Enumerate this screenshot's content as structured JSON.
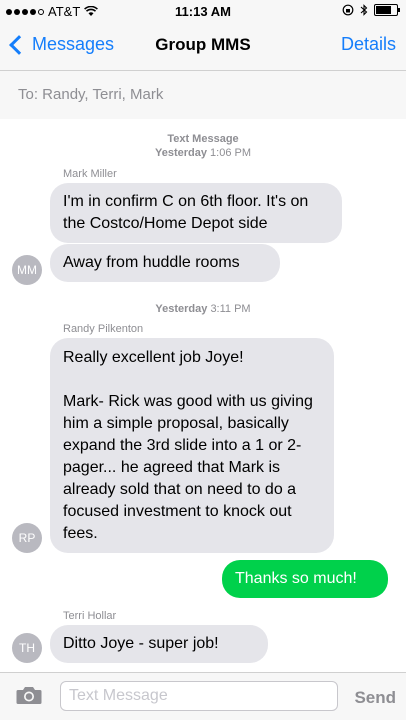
{
  "status_bar": {
    "carrier": "AT&T",
    "time": "11:13 AM",
    "signal_bars_filled": 4,
    "signal_bars_total": 5,
    "battery_level": 0.85
  },
  "nav": {
    "back_label": "Messages",
    "title": "Group MMS",
    "details_label": "Details"
  },
  "to_field": "To: Randy, Terri, Mark",
  "thread": {
    "meta1_title": "Text Message",
    "meta1_day": "Yesterday",
    "meta1_time": "1:06 PM",
    "sender1": "Mark Miller",
    "msg1": "I'm in confirm C on 6th floor. It's on the Costco/Home Depot side",
    "msg2": "Away from huddle rooms",
    "avatar1": "MM",
    "meta2_day": "Yesterday",
    "meta2_time": "3:11 PM",
    "sender2": "Randy Pilkenton",
    "msg3_p1": "Really excellent job Joye!",
    "msg3_p2": "Mark- Rick was good with us giving him a simple proposal, basically expand the 3rd slide into a 1 or 2-pager... he agreed that  Mark is already sold that on need to do a focused investment to knock out fees.",
    "avatar2": "RP",
    "msg4_out": "Thanks so much!",
    "sender3": "Terri Hollar",
    "msg5": "Ditto Joye - super job!",
    "avatar3": "TH"
  },
  "composer": {
    "placeholder": "Text Message",
    "send_label": "Send"
  },
  "colors": {
    "ios_blue": "#157efb",
    "incoming_bubble": "#e5e5ea",
    "outgoing_bubble": "#00d14b",
    "meta_gray": "#8e8e93"
  }
}
